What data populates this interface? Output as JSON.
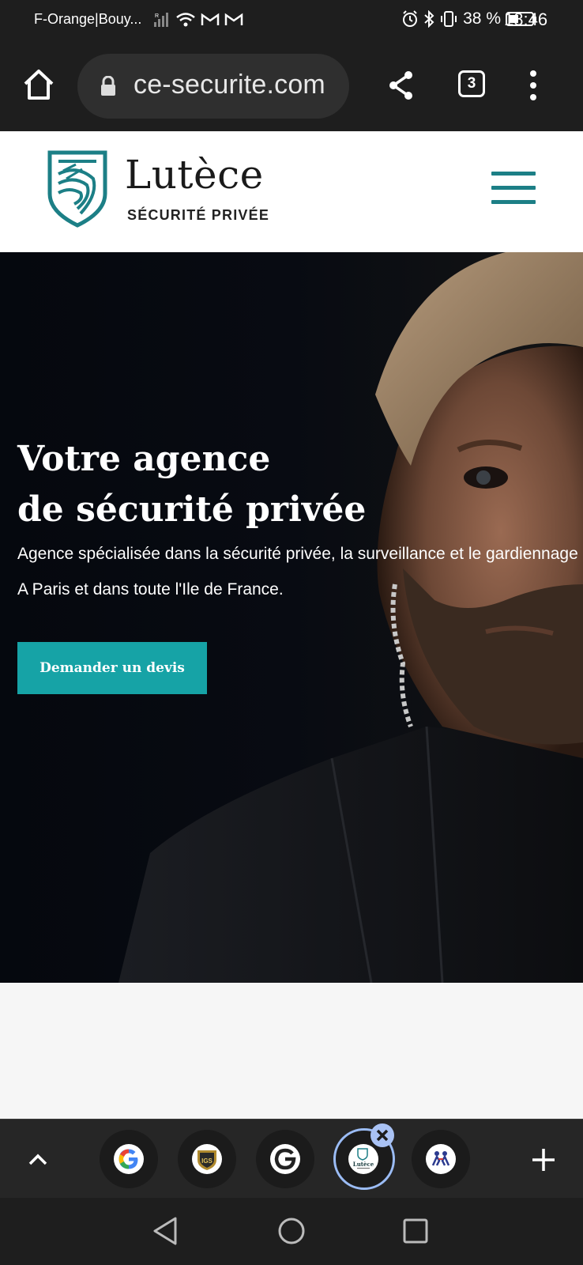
{
  "status_bar": {
    "carrier": "F-Orange|Bouy...",
    "battery": "38 %",
    "time": "18:46"
  },
  "browser": {
    "url": "ce-securite.com",
    "tab_count": "3"
  },
  "site": {
    "logo_title": "Lutèce",
    "logo_subtitle": "SÉCURITÉ PRIVÉE",
    "accent_color": "#16a3a6"
  },
  "hero": {
    "title_line1": "Votre agence",
    "title_line2": "de sécurité privée",
    "description": "Agence spécialisée dans la sécurité privée, la surveillance et le gardiennage",
    "description_line2": "A Paris et dans toute l'Ile de France.",
    "cta_label": "Demander un devis"
  },
  "tab_strip": {
    "tabs": [
      {
        "icon": "google-g-icon"
      },
      {
        "icon": "igs-shield-icon",
        "label": "IGS"
      },
      {
        "icon": "g-logo-icon"
      },
      {
        "icon": "lutece-icon",
        "label": "Lutèce",
        "active": true
      },
      {
        "icon": "people-icon"
      }
    ]
  }
}
